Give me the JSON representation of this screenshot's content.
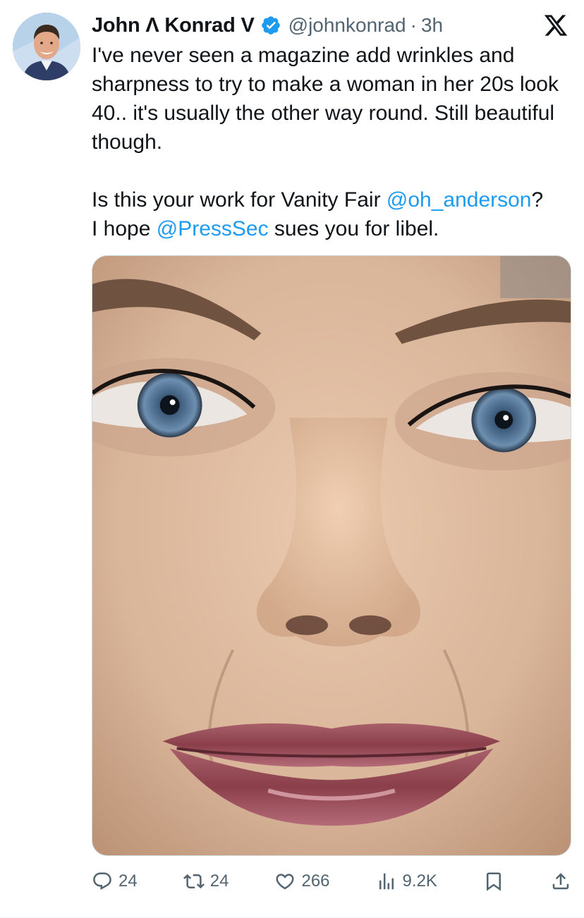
{
  "tweet": {
    "author_name": "John Λ Konrad V",
    "handle": "@johnkonrad",
    "separator": "·",
    "time": "3h",
    "body": {
      "line1": "I've never seen a magazine add wrinkles and sharpness to try to make a woman in her 20s look 40.. it's usually the other way round. Still beautiful though.",
      "line2_prefix": "Is this your work for Vanity Fair ",
      "mention1": "@oh_anderson",
      "line2_suffix": "?",
      "line3_prefix": "I hope ",
      "mention2": "@PressSec",
      "line3_suffix": " sues you for libel."
    },
    "counts": {
      "replies": "24",
      "reposts": "24",
      "likes": "266",
      "views": "9.2K"
    },
    "icons": {
      "reply": "reply-icon",
      "repost": "repost-icon",
      "like": "heart-icon",
      "views": "views-icon",
      "bookmark": "bookmark-icon",
      "share": "share-icon",
      "verified": "verified-badge-icon",
      "logo": "x-logo-icon"
    },
    "colors": {
      "link": "#1d9bf0",
      "secondary": "#536471",
      "verified": "#1d9bf0"
    }
  }
}
